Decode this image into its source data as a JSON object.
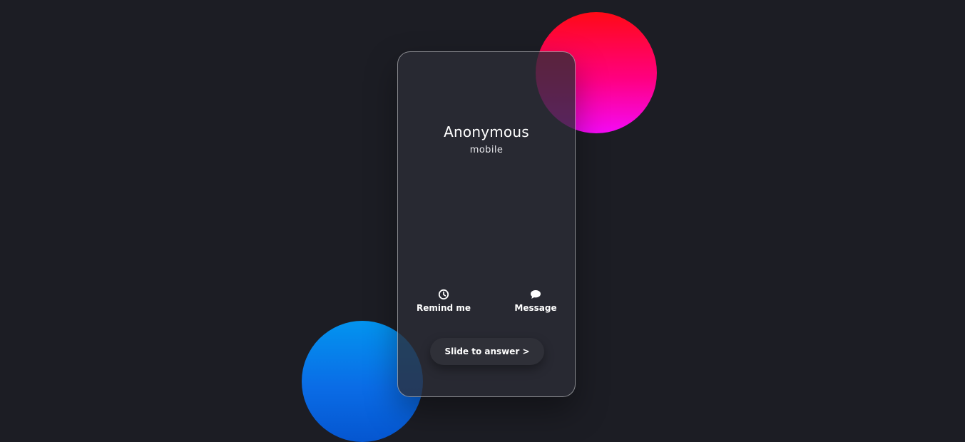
{
  "call": {
    "caller_name": "Anonymous",
    "caller_type": "mobile"
  },
  "actions": [
    {
      "label": "Remind me",
      "icon": "clock-icon"
    },
    {
      "label": "Message",
      "icon": "chat-bubble-icon"
    }
  ],
  "slide": {
    "label": "Slide to answer >"
  },
  "colors": {
    "background": "#1c1d24",
    "orb_red_top": "#ff0a16",
    "orb_red_bottom": "#f40af6",
    "orb_blue_top": "#0394ef",
    "orb_blue_bottom": "#0556d0"
  }
}
